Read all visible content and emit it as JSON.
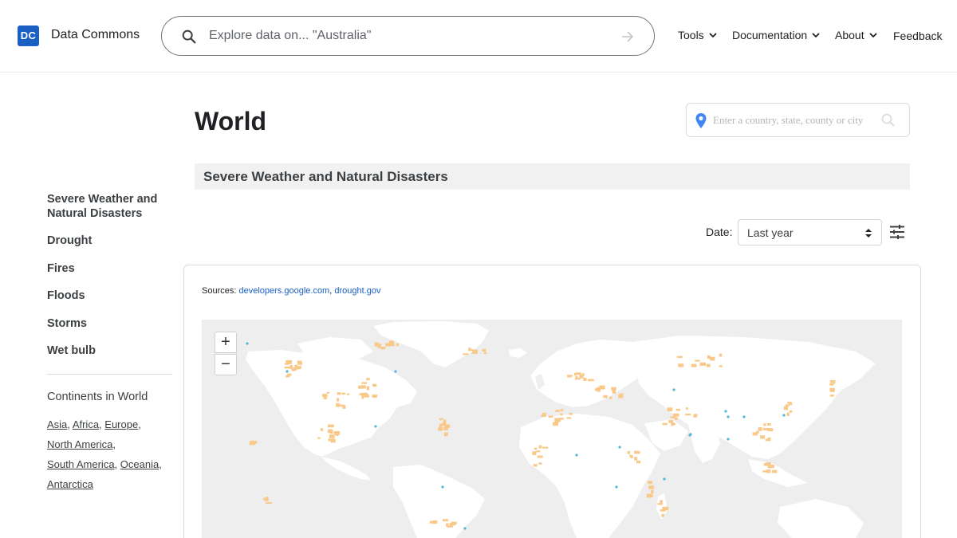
{
  "header": {
    "logo_text": "DC",
    "brand_name": "Data Commons",
    "search_placeholder": "Explore data on... \"Australia\"",
    "nav": {
      "tools": "Tools",
      "documentation": "Documentation",
      "about": "About",
      "feedback": "Feedback"
    }
  },
  "sidebar": {
    "topics": [
      "Severe Weather and Natural Disasters",
      "Drought",
      "Fires",
      "Floods",
      "Storms",
      "Wet bulb"
    ],
    "continents_heading": "Continents in World",
    "continents": [
      "Asia",
      "Africa",
      "Europe",
      "North America",
      "South America",
      "Oceania",
      "Antarctica"
    ]
  },
  "main": {
    "title": "World",
    "place_search_placeholder": "Enter a country, state, county or city",
    "section_title": "Severe Weather and Natural Disasters",
    "date_label": "Date:",
    "date_value": "Last year",
    "sources_label": "Sources:",
    "sources": [
      "developers.google.com",
      "drought.gov"
    ],
    "zoom_in": "+",
    "zoom_out": "−"
  },
  "colors": {
    "brand_blue": "#1a5fc4",
    "fire_orange": "#f9c98a",
    "flood_blue": "#4fb8d8",
    "map_ocean": "#eeeeee",
    "map_land": "#ffffff"
  }
}
